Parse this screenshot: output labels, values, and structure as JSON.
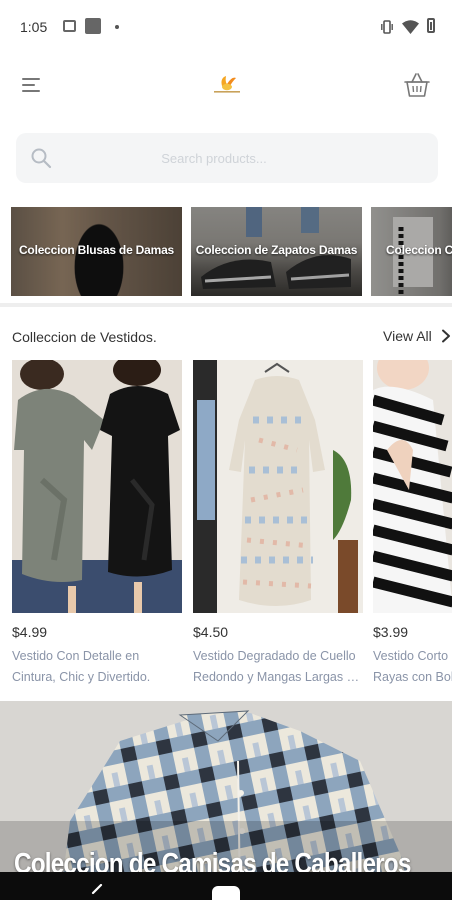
{
  "status_bar": {
    "time": "1:05",
    "icons": [
      "photo-icon",
      "square-icon",
      "dot-icon",
      "vibrate-icon",
      "wifi-icon",
      "battery-icon"
    ]
  },
  "app_bar": {
    "menu_icon": "menu-icon",
    "logo": "brand-logo",
    "cart_icon": "basket-icon"
  },
  "search": {
    "placeholder": "Search products...",
    "value": ""
  },
  "categories": [
    {
      "label": "Coleccion Blusas de Damas"
    },
    {
      "label": "Coleccion de Zapatos Damas"
    },
    {
      "label": "Coleccion Car"
    }
  ],
  "section": {
    "title": "Colleccion de Vestidos.",
    "view_all": "View All"
  },
  "products": [
    {
      "price": "$4.99",
      "name_line1": "Vestido Con Detalle en",
      "name_line2": "Cintura, Chic y Divertido."
    },
    {
      "price": "$4.50",
      "name_line1": "Vestido Degradado de Cuello",
      "name_line2": "Redondo y Mangas Largas co..."
    },
    {
      "price": "$3.99",
      "name_line1": "Vestido Corto",
      "name_line2": "Rayas con Bol"
    }
  ],
  "banner": {
    "title": "Coleccion de Camisas de Caballeros"
  },
  "colors": {
    "product_name": "#8a94a8",
    "search_bg": "#f4f5f6",
    "accent_logo": "#f5a623"
  }
}
